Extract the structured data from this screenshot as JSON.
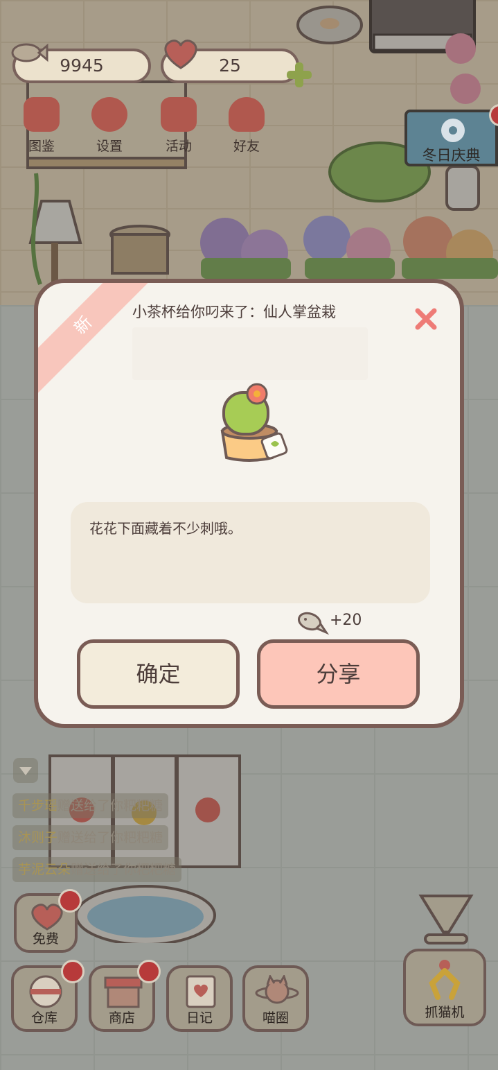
{
  "hud": {
    "fish_currency": "9945",
    "heart_currency": "25"
  },
  "top_menu": [
    {
      "label": "图鉴",
      "icon": "cat-book-icon"
    },
    {
      "label": "设置",
      "icon": "gear-icon"
    },
    {
      "label": "活动",
      "icon": "gift-icon"
    },
    {
      "label": "好友",
      "icon": "friends-icon"
    }
  ],
  "event_banner": {
    "label": "冬日庆典",
    "icon": "snowflake-icon"
  },
  "gift_feed": [
    {
      "name": "千步瑶",
      "text": "赠送给了你粑粑糖"
    },
    {
      "name": "沐则子",
      "text": "赠送给了你粑粑糖"
    },
    {
      "name": "芋泥云朵",
      "text": "赠送给了你粑粑糖"
    }
  ],
  "bottom_bar": {
    "free": "免费",
    "warehouse": "仓库",
    "shop": "商店",
    "diary": "日记",
    "cat_circle": "喵圈",
    "claw_machine": "抓猫机"
  },
  "modal": {
    "badge": "新",
    "title": "小茶杯给你叼来了：仙人掌盆栽",
    "description": "花花下面藏着不少刺哦。",
    "reward_amount": "+20",
    "confirm_label": "确定",
    "share_label": "分享"
  },
  "colors": {
    "modal_border": "#7a5c55",
    "share_button": "#fdc6b9",
    "confirm_button": "#f3ecdb",
    "close_x": "#ee7b76",
    "badge": "#f8c6bc"
  }
}
